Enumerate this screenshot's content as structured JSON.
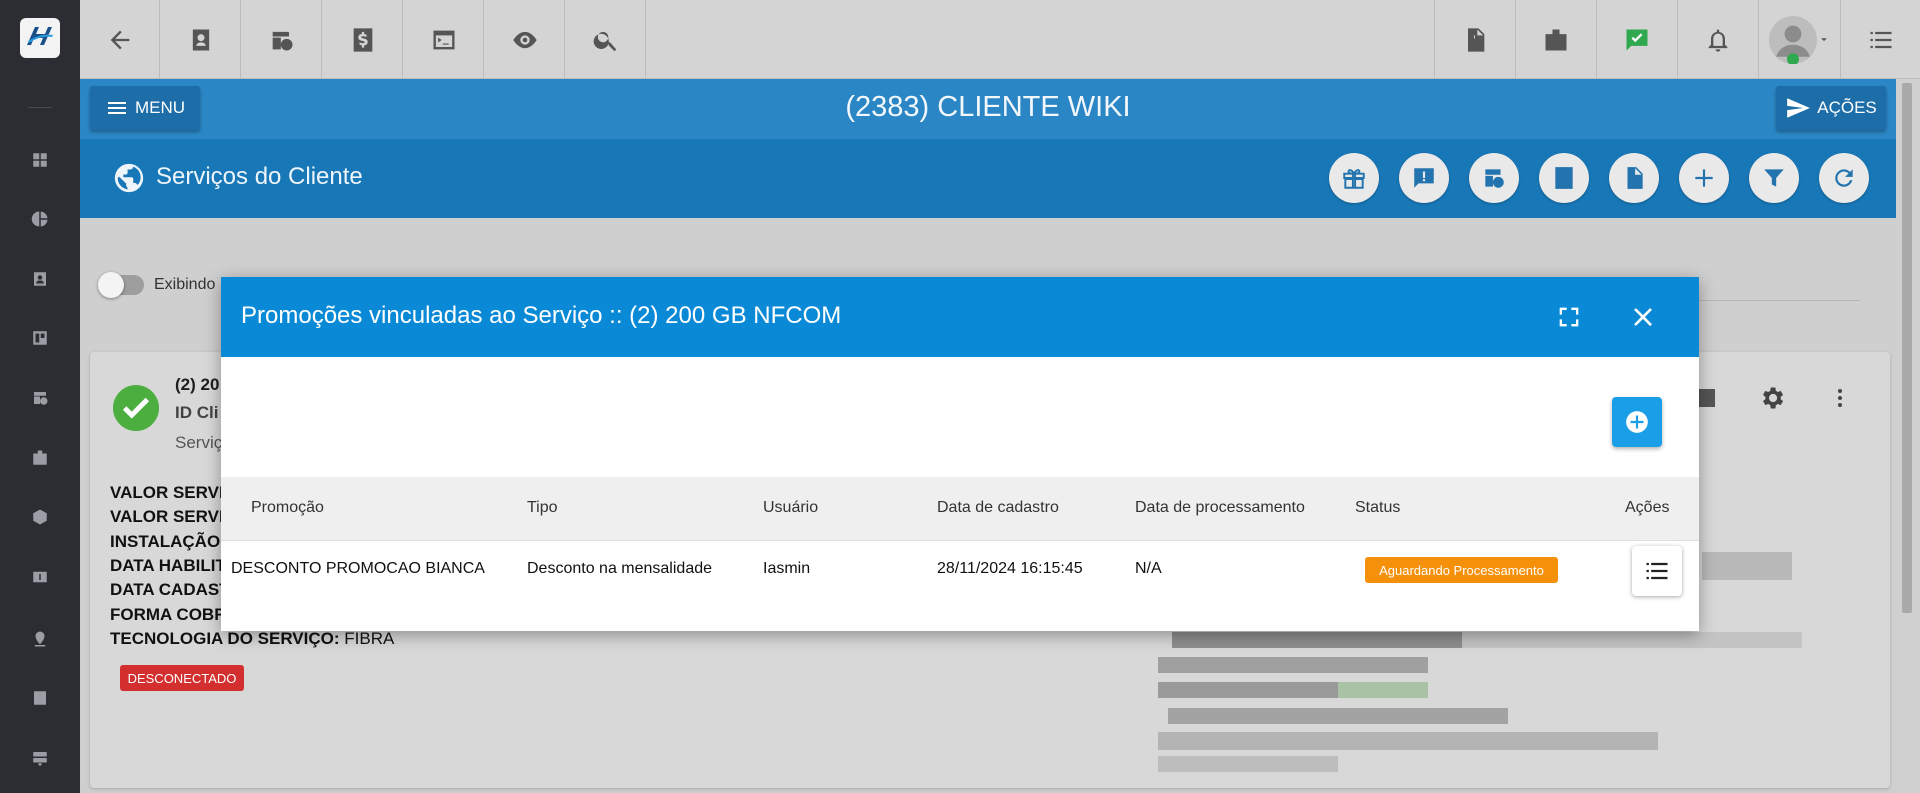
{
  "header": {
    "client_title": "(2383) CLIENTE WIKI",
    "menu_label": "MENU",
    "actions_label": "AÇÕES"
  },
  "section": {
    "title": "Serviços do Cliente"
  },
  "filter": {
    "toggle_label": "Exibindo"
  },
  "service_card": {
    "name_partial": "(2) 20",
    "id_partial": "ID Cli",
    "sub_partial": "Serviç",
    "fields": [
      {
        "label": "VALOR SERVIC",
        "value": ""
      },
      {
        "label": "VALOR SERVIC",
        "value": ""
      },
      {
        "label": "INSTALAÇÃO:",
        "value": ""
      },
      {
        "label": "DATA HABILIT",
        "value": ""
      },
      {
        "label": "DATA CADAST",
        "value": ""
      },
      {
        "label": "FORMA COBR.",
        "value": ""
      },
      {
        "label": "TECNOLOGIA DO SERVIÇO:",
        "value": " FIBRA"
      }
    ],
    "status_badge": "DESCONECTADO"
  },
  "modal": {
    "title": "Promoções vinculadas ao Serviço :: (2) 200 GB NFCOM",
    "columns": [
      "Promoção",
      "Tipo",
      "Usuário",
      "Data de cadastro",
      "Data de processamento",
      "Status",
      "Ações"
    ],
    "rows": [
      {
        "promocao": "DESCONTO PROMOCAO BIANCA",
        "tipo": "Desconto na mensalidade",
        "usuario": "Iasmin",
        "data_cadastro": "28/11/2024 16:15:45",
        "data_processamento": "N/A",
        "status": "Aguardando Processamento"
      }
    ]
  },
  "colors": {
    "primary_blue": "#1877b7",
    "modal_header": "#0a8ad6",
    "status_pending": "#f5900b",
    "status_disconnected": "#d32f2f",
    "success": "#4bae3f"
  }
}
